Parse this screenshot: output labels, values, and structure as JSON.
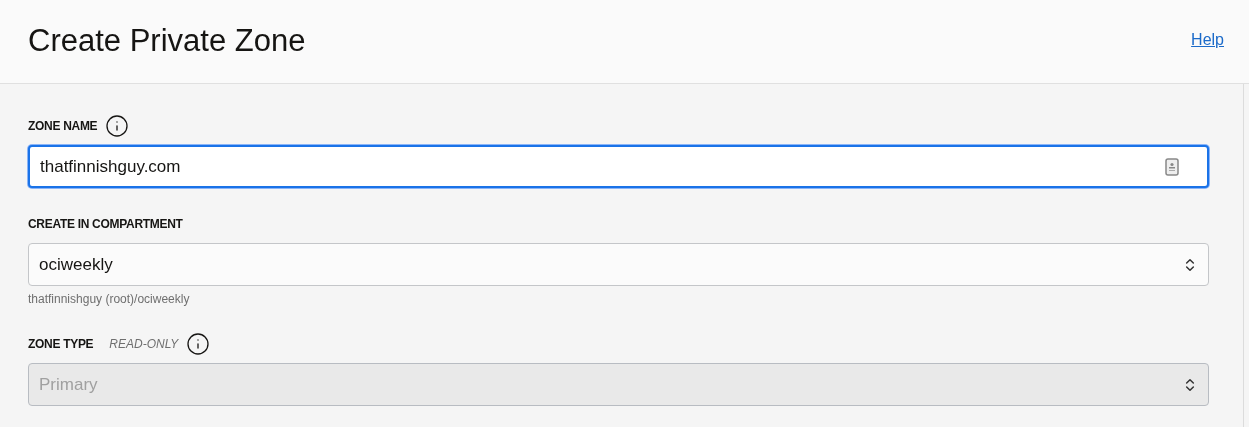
{
  "header": {
    "title": "Create Private Zone",
    "help_link": "Help"
  },
  "fields": [
    {
      "kind": "text",
      "label": "ZONE NAME",
      "info": true,
      "value": "thatfinnishguy.com",
      "focused": true,
      "disabled": false
    },
    {
      "kind": "select",
      "label": "CREATE IN COMPARTMENT",
      "info": false,
      "value": "ociweekly",
      "hint": "thatfinnishguy (root)/ociweekly",
      "focused": false,
      "disabled": false
    },
    {
      "kind": "select",
      "label": "ZONE TYPE",
      "note": "READ-ONLY",
      "info": true,
      "value": "Primary",
      "focused": false,
      "disabled": true
    }
  ]
}
